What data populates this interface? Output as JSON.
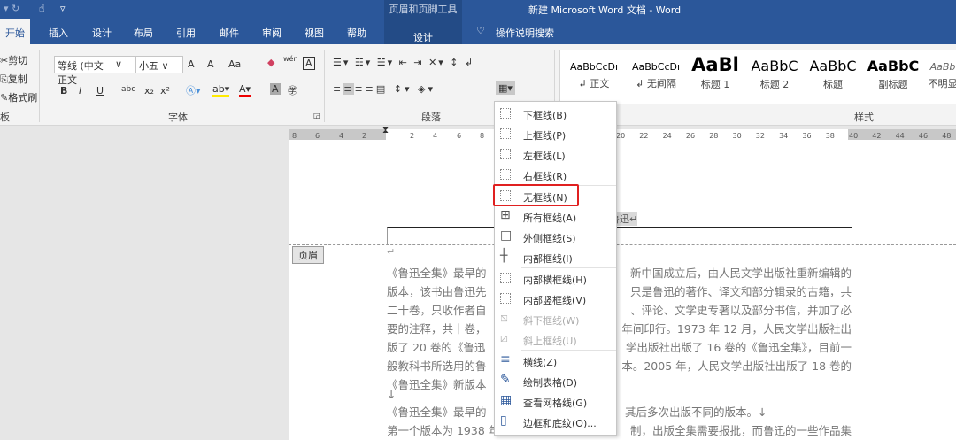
{
  "title": "新建 Microsoft Word 文档  -  Word",
  "context_tool": "页眉和页脚工具",
  "tabs": [
    "开始",
    "插入",
    "设计",
    "布局",
    "引用",
    "邮件",
    "审阅",
    "视图",
    "帮助",
    "设计"
  ],
  "search": "操作说明搜索",
  "clipboard": {
    "cut": "剪切",
    "copy": "复制",
    "format_painter": "格式刷",
    "group": "板"
  },
  "font": {
    "name": "等线 (中文正文",
    "size": "小五",
    "group": "字体",
    "bold": "B",
    "italic": "I",
    "underline": "U",
    "strike": "abc",
    "sub": "x₂",
    "sup": "x²",
    "grow": "A",
    "shrink": "A",
    "case": "Aa",
    "pinyin": "wén",
    "border": "A"
  },
  "paragraph": {
    "group": "段落"
  },
  "styles": {
    "group": "样式",
    "items": [
      {
        "sample": "AaBbCcDı",
        "label": "↲ 正文"
      },
      {
        "sample": "AaBbCcDı",
        "label": "↲ 无间隔"
      },
      {
        "sample": "AaBl",
        "label": "标题 1"
      },
      {
        "sample": "AaBbC",
        "label": "标题 2"
      },
      {
        "sample": "AaBbC",
        "label": "标题"
      },
      {
        "sample": "AaBbC",
        "label": "副标题"
      },
      {
        "sample": "AaBb",
        "label": "不明显"
      }
    ]
  },
  "ruler": {
    "left": [
      "8",
      "6",
      "4",
      "2"
    ],
    "right": [
      "2",
      "4",
      "6",
      "8"
    ],
    "right2": [
      "20",
      "22",
      "24",
      "26",
      "28",
      "30",
      "32",
      "34",
      "36",
      "38",
      "40",
      "42",
      "44",
      "46",
      "48"
    ]
  },
  "doc": {
    "header_label": "页眉",
    "header_text": "鲁迅↵",
    "mark": "↵",
    "lines": [
      {
        "l": "《鲁迅全集》最早的",
        "r": "新中国成立后，由人民文学出版社重新编辑的"
      },
      {
        "l": "版本，该书由鲁迅先",
        "r": "只是鲁迅的著作、译文和部分辑录的古籍，共"
      },
      {
        "l": "二十卷，只收作者自",
        "r": "、评论、文学史专著以及部分书信，并加了必"
      },
      {
        "l": "要的注释，共十卷，",
        "r": "年间印行。1973 年 12 月，人民文学出版社出"
      },
      {
        "l": "版了 20 卷的《鲁迅",
        "r": "学出版社出版了 16 卷的《鲁迅全集》，目前一"
      },
      {
        "l": "般教科书所选用的鲁",
        "r": "本。2005 年，人民文学出版社出版了 18 卷的"
      },
      {
        "l": "《鲁迅全集》新版本",
        "r": ""
      },
      {
        "l": "↓",
        "r": ""
      },
      {
        "l": "《鲁迅全集》最早的",
        "r": "其后多次出版不同的版本。↓"
      },
      {
        "l": "第一个版本为 1938 年",
        "r": "制，出版全集需要报批，而鲁迅的一些作品集"
      }
    ]
  },
  "menu": [
    {
      "label": "下框线(B)",
      "icon": "border-bottom-icon"
    },
    {
      "label": "上框线(P)",
      "icon": "border-top-icon"
    },
    {
      "label": "左框线(L)",
      "icon": "border-left-icon"
    },
    {
      "label": "右框线(R)",
      "icon": "border-right-icon"
    },
    {
      "label": "无框线(N)",
      "icon": "no-border-icon"
    },
    {
      "label": "所有框线(A)",
      "icon": "all-borders-icon"
    },
    {
      "label": "外侧框线(S)",
      "icon": "outside-borders-icon"
    },
    {
      "label": "内部框线(I)",
      "icon": "inside-borders-icon"
    },
    {
      "label": "内部横框线(H)",
      "icon": "inside-horizontal-border-icon"
    },
    {
      "label": "内部竖框线(V)",
      "icon": "inside-vertical-border-icon"
    },
    {
      "label": "斜下框线(W)",
      "icon": "diagonal-down-border-icon"
    },
    {
      "label": "斜上框线(U)",
      "icon": "diagonal-up-border-icon"
    },
    {
      "label": "横线(Z)",
      "icon": "horizontal-line-icon"
    },
    {
      "label": "绘制表格(D)",
      "icon": "draw-table-icon"
    },
    {
      "label": "查看网格线(G)",
      "icon": "view-gridlines-icon"
    },
    {
      "label": "边框和底纹(O)...",
      "icon": "borders-shading-icon"
    }
  ],
  "colors": {
    "brand": "#2b579a",
    "highlight_box": "#e02020"
  }
}
